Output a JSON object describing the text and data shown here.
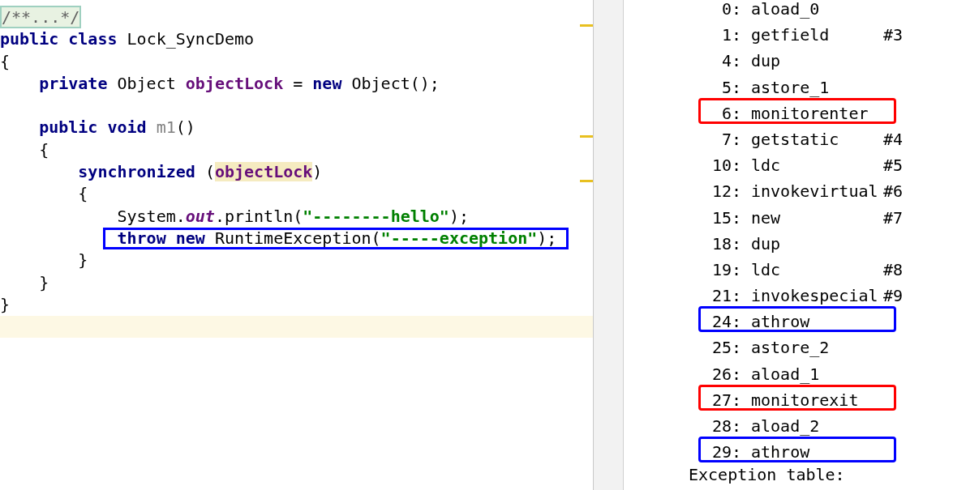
{
  "code": [
    {
      "current": false,
      "tokens": [
        {
          "text": "/**...*/",
          "kind": "fold"
        }
      ]
    },
    {
      "current": false,
      "tokens": [
        {
          "text": "public class ",
          "kind": "keyword"
        },
        {
          "text": "Lock_SyncDemo",
          "kind": "plain"
        }
      ]
    },
    {
      "current": false,
      "tokens": [
        {
          "text": "{",
          "kind": "plain"
        }
      ],
      "children": [
        {
          "current": false,
          "tokens": [
            {
              "text": "private",
              "kind": "keyword"
            },
            {
              "text": " Object ",
              "kind": "plain"
            },
            {
              "text": "objectLock",
              "kind": "field",
              "highlighted": false
            },
            {
              "text": " = ",
              "kind": "plain"
            },
            {
              "text": "new",
              "kind": "keyword"
            },
            {
              "text": " Object();",
              "kind": "plain"
            }
          ]
        },
        {
          "current": false
        },
        {
          "current": false,
          "tokens": [
            {
              "text": "public void ",
              "kind": "keyword"
            },
            {
              "text": "m1",
              "kind": "unused"
            },
            {
              "text": "()",
              "kind": "plain"
            }
          ]
        },
        {
          "current": false,
          "tokens": [
            {
              "text": "{",
              "kind": "plain"
            }
          ],
          "children": [
            {
              "current": false,
              "tokens": [
                {
                  "text": "synchronized ",
                  "kind": "keyword"
                },
                {
                  "text": "(",
                  "kind": "plain"
                },
                {
                  "text": "objectLock",
                  "kind": "field",
                  "highlighted": true
                },
                {
                  "text": ")",
                  "kind": "plain"
                }
              ]
            },
            {
              "current": false,
              "tokens": [
                {
                  "text": "{",
                  "kind": "plain"
                }
              ],
              "children": [
                {
                  "current": false,
                  "tokens": [
                    {
                      "text": "System.",
                      "kind": "plain"
                    },
                    {
                      "text": "out",
                      "kind": "static"
                    },
                    {
                      "text": ".println(",
                      "kind": "plain"
                    },
                    {
                      "text": "\"--------hello\"",
                      "kind": "string"
                    },
                    {
                      "text": ");",
                      "kind": "plain"
                    }
                  ]
                },
                {
                  "current": false,
                  "color": "#0000ff",
                  "tokens": [
                    {
                      "text": "throw new ",
                      "kind": "keyword"
                    },
                    {
                      "text": "RuntimeException(",
                      "kind": "plain"
                    },
                    {
                      "text": "\"-----exception\"",
                      "kind": "string"
                    },
                    {
                      "text": ");",
                      "kind": "plain"
                    }
                  ]
                }
              ]
            },
            {
              "current": false,
              "tokens": [
                {
                  "text": "}",
                  "kind": "plain"
                }
              ]
            }
          ]
        },
        {
          "current": false,
          "tokens": [
            {
              "text": "}",
              "kind": "plain"
            }
          ]
        }
      ]
    },
    {
      "current": false,
      "tokens": [
        {
          "text": "}",
          "kind": "plain"
        }
      ]
    },
    {
      "current": true
    }
  ],
  "bytecode": [
    {
      "offset": "0:",
      "op": "aload_0"
    },
    {
      "offset": "1:",
      "op": "getfield",
      "arg": "#3"
    },
    {
      "offset": "4:",
      "op": "dup"
    },
    {
      "offset": "5:",
      "op": "astore_1"
    },
    {
      "offset": "6:",
      "op": "monitorenter",
      "color": "#ff0000"
    },
    {
      "offset": "7:",
      "op": "getstatic",
      "arg": "#4"
    },
    {
      "offset": "10:",
      "op": "ldc",
      "arg": "#5"
    },
    {
      "offset": "12:",
      "op": "invokevirtual",
      "arg": "#6"
    },
    {
      "offset": "15:",
      "op": "new",
      "arg": "#7"
    },
    {
      "offset": "18:",
      "op": "dup"
    },
    {
      "offset": "19:",
      "op": "ldc",
      "arg": "#8"
    },
    {
      "offset": "21:",
      "op": "invokespecial",
      "arg": "#9"
    },
    {
      "offset": "24:",
      "op": "athrow",
      "color": "#0000ff"
    },
    {
      "offset": "25:",
      "op": "astore_2"
    },
    {
      "offset": "26:",
      "op": "aload_1"
    },
    {
      "offset": "27:",
      "op": "monitorexit",
      "color": "#ff0000"
    },
    {
      "offset": "28:",
      "op": "aload_2"
    },
    {
      "offset": "29:",
      "op": "athrow",
      "color": "#0000ff"
    }
  ],
  "exception_table_heading": "Exception table:"
}
